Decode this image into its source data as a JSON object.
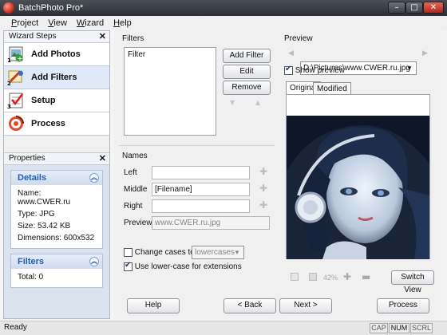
{
  "window": {
    "title": "BatchPhoto Pro*",
    "minimize": "–",
    "maximize": "□",
    "close": "✕"
  },
  "menu": [
    "Project",
    "View",
    "Wizard",
    "Help"
  ],
  "wizard": {
    "header": "Wizard Steps",
    "close": "✕",
    "steps": [
      {
        "label": "Add Photos",
        "num": "1"
      },
      {
        "label": "Add Filters",
        "num": "2"
      },
      {
        "label": "Setup",
        "num": "3"
      },
      {
        "label": "Process",
        "num": ""
      }
    ]
  },
  "properties": {
    "header": "Properties",
    "close": "✕",
    "details": {
      "title": "Details",
      "rows": [
        "Name: www.CWER.ru",
        "Type: JPG",
        "Size: 53.42 KB",
        "Dimensions: 600x532"
      ]
    },
    "filters": {
      "title": "Filters",
      "rows": [
        "Total: 0"
      ]
    }
  },
  "filters": {
    "label": "Filters",
    "list_header": "Filter",
    "add": "Add Filter",
    "edit": "Edit",
    "remove": "Remove",
    "up": "▼",
    "down": "▲"
  },
  "names": {
    "label": "Names",
    "left_label": "Left",
    "middle_label": "Middle",
    "middle_value": "[Filename]",
    "right_label": "Right",
    "preview_label": "Preview",
    "preview_value": "www.CWER.ru.jpg",
    "change_cases": "Change cases to",
    "case_value": "lowercases",
    "lowercase_ext": "Use lower-case for extensions"
  },
  "preview": {
    "label": "Preview",
    "path": "D:\\Pictures\\www.CWER.ru.jpg",
    "show_preview": "Show preview",
    "tab_original": "Original",
    "tab_modified": "Modified",
    "zoom": "42%",
    "switch_view": "Switch View"
  },
  "footer": {
    "help": "Help",
    "back": "< Back",
    "next": "Next >",
    "process": "Process"
  },
  "status": {
    "text": "Ready",
    "cap": "CAP",
    "num": "NUM",
    "scrl": "SCRL"
  }
}
